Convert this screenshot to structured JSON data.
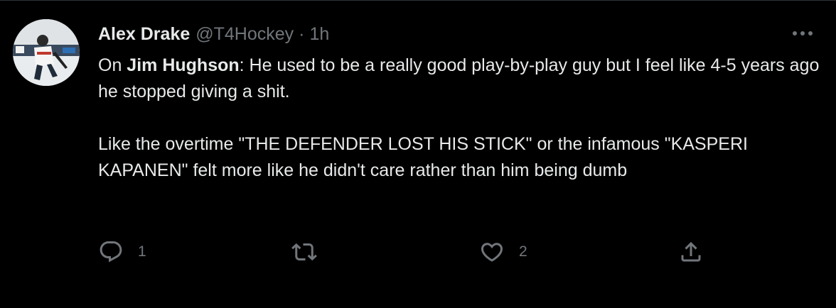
{
  "tweet": {
    "author_name": "Alex Drake",
    "author_handle": "@T4Hockey",
    "separator": "·",
    "timestamp": "1h",
    "text_prefix": "On ",
    "mention": "Jim Hughson",
    "paragraph1_rest": ": He used to be a really good play-by-play guy but I feel like 4-5 years ago he stopped giving a shit.",
    "paragraph2": "Like the overtime \"THE DEFENDER LOST HIS STICK\" or the infamous \"KASPERI KAPANEN\" felt more like he didn't care rather than him being dumb"
  },
  "actions": {
    "reply_count": "1",
    "retweet_count": "",
    "like_count": "2"
  },
  "icons": {
    "reply": "reply-icon",
    "retweet": "retweet-icon",
    "like": "heart-icon",
    "share": "share-icon",
    "more": "more-icon"
  },
  "colors": {
    "background": "#000000",
    "text_primary": "#e7e9ea",
    "text_secondary": "#71767b",
    "divider": "#2f3336"
  }
}
